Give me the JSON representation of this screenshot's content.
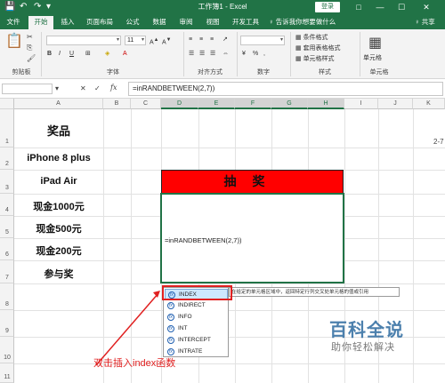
{
  "window": {
    "title": "工作簿1 - Excel",
    "login_label": "登录"
  },
  "window_controls": {
    "ribbon_options": "□",
    "minimize": "—",
    "restore": "☐",
    "close": "✕"
  },
  "quick_access": {
    "save_glyph": "💾",
    "undo_glyph": "↶",
    "redo_glyph": "↷",
    "more_glyph": "▾"
  },
  "tabs": [
    {
      "label": "文件"
    },
    {
      "label": "开始"
    },
    {
      "label": "插入"
    },
    {
      "label": "页面布局"
    },
    {
      "label": "公式"
    },
    {
      "label": "数据"
    },
    {
      "label": "审阅"
    },
    {
      "label": "视图"
    },
    {
      "label": "开发工具"
    }
  ],
  "active_tab": "开始",
  "tell_me": "♀ 告诉我你想要做什么",
  "share": "♀ 共享",
  "ribbon": {
    "groups": {
      "clipboard": "剪贴板",
      "font": "字体",
      "alignment": "对齐方式",
      "number": "数字",
      "styles": "样式",
      "cells": "单元格"
    },
    "font_size": "11",
    "font_name": "",
    "styles": {
      "conditional": "条件格式",
      "table": "套用表格格式",
      "cell": "单元格样式"
    },
    "cells_label": "单元格",
    "font_buttons": {
      "bold": "B",
      "italic": "I",
      "underline": "U"
    },
    "number_buttons": {
      "percent": "%",
      "comma": ","
    },
    "chevron": "▾"
  },
  "formula_bar": {
    "cancel": "✕",
    "enter": "✓",
    "fx": "fx",
    "value": "=inRANDBETWEEN(2,7))"
  },
  "columns": [
    {
      "name": "A",
      "sel": false
    },
    {
      "name": "B",
      "sel": false
    },
    {
      "name": "C",
      "sel": false
    },
    {
      "name": "D",
      "sel": true
    },
    {
      "name": "E",
      "sel": true
    },
    {
      "name": "F",
      "sel": true
    },
    {
      "name": "G",
      "sel": true
    },
    {
      "name": "H",
      "sel": true
    },
    {
      "name": "I",
      "sel": false
    },
    {
      "name": "J",
      "sel": false
    },
    {
      "name": "K",
      "sel": false
    }
  ],
  "rows": [
    "1",
    "2",
    "3",
    "4",
    "5",
    "6",
    "7",
    "8",
    "9",
    "10",
    "11"
  ],
  "prizes": [
    "奖品",
    "iPhone 8 plus",
    "iPad Air",
    "现金1000元",
    "现金500元",
    "现金200元",
    "参与奖"
  ],
  "draw_title": "抽奖",
  "edit_cell_text": "=inRANDBETWEEN(2,7))",
  "autocomplete": [
    "INDEX",
    "INDIRECT",
    "INFO",
    "INT",
    "INTERCEPT",
    "INTRATE"
  ],
  "autocomplete_icon": "fx",
  "autocomplete_tip": "在给定的单元格区域中，返回特定行列交叉处单元格的值或引用",
  "annotation": "双击插入index函数",
  "side_fragment": "2-7",
  "watermark": {
    "title": "百科全说",
    "subtitle": "助你轻松解决"
  },
  "colors": {
    "excel_green": "#217346",
    "banner_red": "#ff0000",
    "annotation_red": "#e02020"
  }
}
